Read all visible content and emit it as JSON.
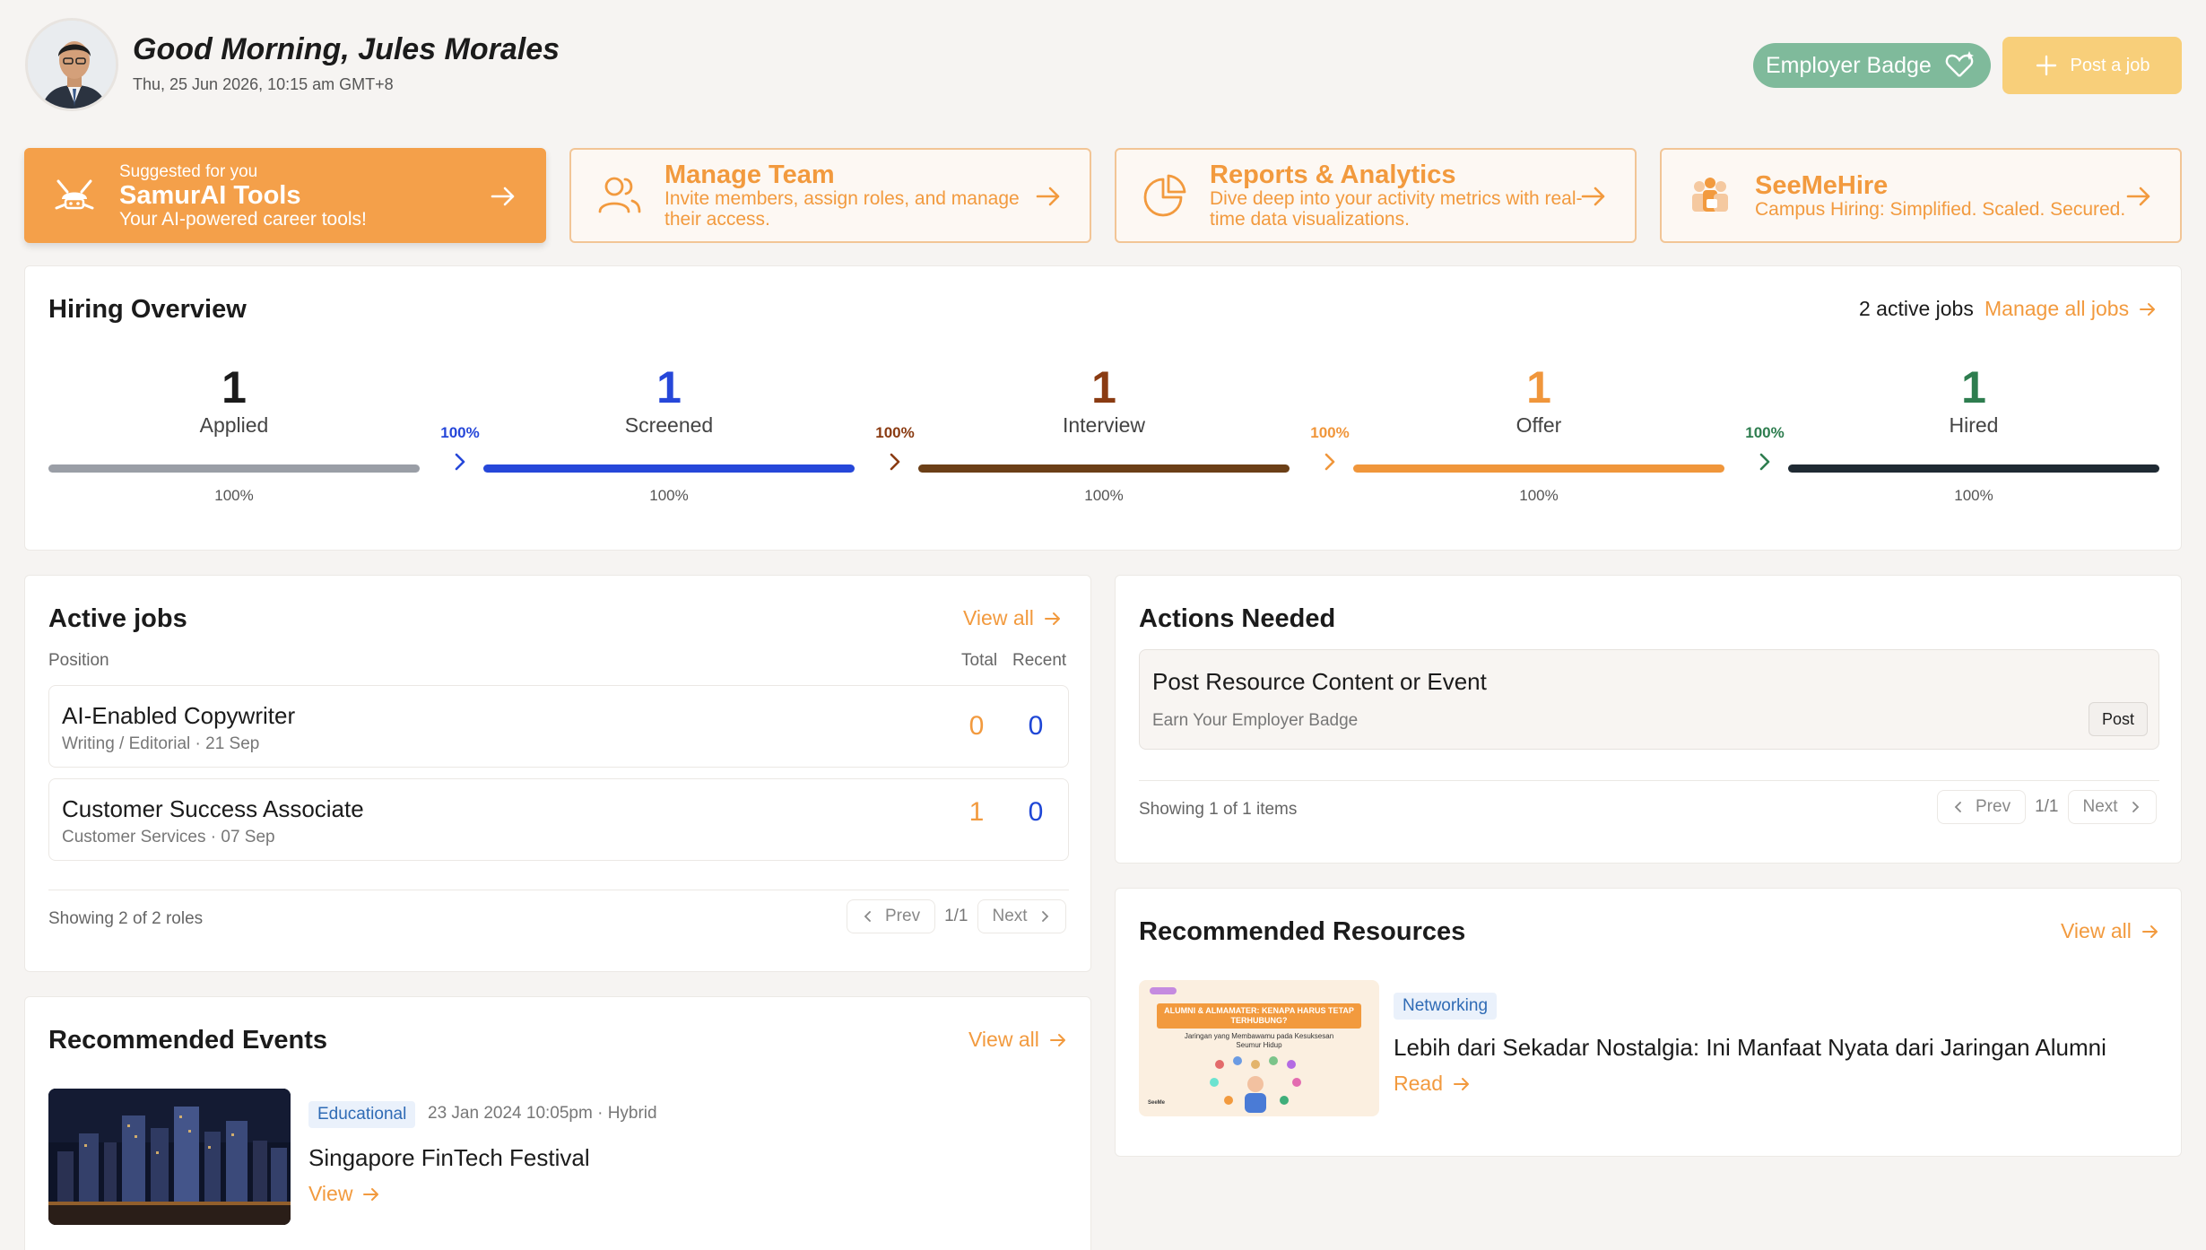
{
  "header": {
    "greeting": "Good Morning, Jules Morales",
    "datetime": "Thu, 25 Jun 2026, 10:15 am GMT+8",
    "employer_badge_label": "Employer Badge",
    "post_job_label": "Post a job"
  },
  "quick_cards": [
    {
      "small": "Suggested for you",
      "title": "SamurAI Tools",
      "desc": "Your AI-powered career tools!"
    },
    {
      "title": "Manage Team",
      "desc": "Invite members, assign roles, and manage their access."
    },
    {
      "title": "Reports & Analytics",
      "desc": "Dive deep into your activity metrics with real-time data visualizations."
    },
    {
      "title": "SeeMeHire",
      "desc": "Campus Hiring: Simplified. Scaled. Secured."
    }
  ],
  "hiring_overview": {
    "title": "Hiring Overview",
    "active_jobs_text": "2 active jobs",
    "manage_link": "Manage all jobs",
    "stages": [
      {
        "count": "1",
        "label": "Applied",
        "pct": "100%",
        "color": "#9a9ea6",
        "fill": 1.0
      },
      {
        "count": "1",
        "label": "Screened",
        "pct": "100%",
        "color": "#2647d9",
        "fill": 1.0
      },
      {
        "count": "1",
        "label": "Interview",
        "pct": "100%",
        "color": "#6b3f17",
        "fill": 1.0
      },
      {
        "count": "1",
        "label": "Offer",
        "pct": "100%",
        "color": "#f0963b",
        "fill": 1.0
      },
      {
        "count": "1",
        "label": "Hired",
        "pct": "100%",
        "color": "#1f2a33",
        "fill": 1.0
      }
    ],
    "conversions": [
      {
        "pct": "100%",
        "color": "#2647d9"
      },
      {
        "pct": "100%",
        "color": "#8a3b12"
      },
      {
        "pct": "100%",
        "color": "#f0963b"
      },
      {
        "pct": "100%",
        "color": "#2e7d4f"
      }
    ]
  },
  "active_jobs": {
    "title": "Active jobs",
    "view_all": "View all",
    "col_position": "Position",
    "col_total": "Total",
    "col_recent": "Recent",
    "rows": [
      {
        "title": "AI-Enabled Copywriter",
        "sub": "Writing / Editorial · 21 Sep",
        "total": "0",
        "recent": "0"
      },
      {
        "title": "Customer Success Associate",
        "sub": "Customer Services · 07 Sep",
        "total": "1",
        "recent": "0"
      }
    ],
    "showing": "Showing 2 of 2 roles",
    "prev": "Prev",
    "page": "1/1",
    "next": "Next"
  },
  "actions_needed": {
    "title": "Actions Needed",
    "item_title": "Post Resource Content or Event",
    "item_sub": "Earn Your Employer Badge",
    "item_button": "Post",
    "showing": "Showing 1 of 1 items",
    "prev": "Prev",
    "page": "1/1",
    "next": "Next"
  },
  "recommended_events": {
    "title": "Recommended Events",
    "view_all": "View all",
    "event": {
      "tag": "Educational",
      "meta": "23 Jan 2024 10:05pm · Hybrid",
      "title": "Singapore FinTech Festival",
      "action": "View"
    }
  },
  "recommended_resources": {
    "title": "Recommended Resources",
    "view_all": "View all",
    "resource": {
      "tag": "Networking",
      "title": "Lebih dari Sekadar Nostalgia: Ini Manfaat Nyata dari Jaringan Alumni",
      "action": "Read",
      "thumb_heading": "ALUMNI & ALMAMATER: KENAPA HARUS TETAP TERHUBUNG?",
      "thumb_sub": "Jaringan yang Membawamu pada Kesuksesan Seumur Hidup"
    }
  }
}
